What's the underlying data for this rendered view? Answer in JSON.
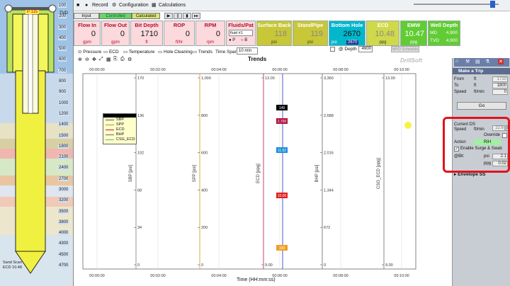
{
  "well": {
    "depths": [
      "100",
      "200",
      "300",
      "400",
      "500",
      "600",
      "700",
      "800",
      "900",
      "1000",
      "1200",
      "1400",
      "1500",
      "1800",
      "2100",
      "2400",
      "2700",
      "3000",
      "3200",
      "3500",
      "3800",
      "4000",
      "4300",
      "4500",
      "4700"
    ],
    "top_badge": "P 115",
    "bottom_label_1": "Sand Scan",
    "bottom_label_2": "ECD 10.48"
  },
  "toolbar": {
    "record": "Record",
    "configuration": "Configuration",
    "calculations": "Calculations",
    "tvd": "TVD"
  },
  "tabs": {
    "input": "Input",
    "controlled": "Controlled",
    "calculated": "Calculated"
  },
  "tiles": [
    {
      "title": "Flow In",
      "value": "0",
      "unit": "gpm"
    },
    {
      "title": "Flow Out",
      "value": "0",
      "unit": "gpm"
    },
    {
      "title": "Bit Depth",
      "value": "1710",
      "unit": "ft"
    },
    {
      "title": "ROP",
      "value": "0",
      "unit": "ft/hr"
    },
    {
      "title": "RPM",
      "value": "0",
      "unit": "rpm"
    }
  ],
  "fluids": {
    "title": "Fluids/Pat",
    "select": "fluid #1",
    "p": "P",
    "b": "B"
  },
  "pressure_tiles": [
    {
      "title": "Surface Back",
      "value": "118",
      "unit": "psi"
    },
    {
      "title": "StandPipe",
      "value": "119",
      "unit": "psi"
    },
    {
      "title": "Bottom Hole",
      "value": "2670",
      "unit": "psi",
      "extra": "2670"
    },
    {
      "title": "ECD",
      "value": "10.48",
      "unit": "ppg"
    },
    {
      "title": "EMW",
      "value": "10.47",
      "unit": "ppg"
    }
  ],
  "well_depth": {
    "title": "Well Depth",
    "md_label": "MD",
    "md": "4,900",
    "tvd_label": "TVD",
    "tvd": "4,900"
  },
  "depth_row": {
    "at_depth": "@ Depth",
    "depth_val": "4900",
    "mpd_btn": "MPD Schedule"
  },
  "view_tabs": [
    "Pressure",
    "ECD",
    "Temperature",
    "Hole Cleaning",
    "Trends"
  ],
  "time_span_label": "Time Span",
  "time_span_value": "10 min",
  "chart_title": "Trends",
  "brand": "DrillSoft",
  "chart_data": {
    "type": "line",
    "title": "Trends",
    "xlabel": "Time (HH:mm:ss)",
    "x_ticks": [
      "00:00:00",
      "00:02:00",
      "00:04:00",
      "00:06:00",
      "00:08:00",
      "00:10:00"
    ],
    "axes": [
      {
        "name": "SBP [psi]",
        "ticks": [
          "0",
          "34",
          "68",
          "102",
          "136",
          "170"
        ]
      },
      {
        "name": "SPP [psi]",
        "ticks": [
          "0",
          "200",
          "400",
          "600",
          "800",
          "1,000"
        ]
      },
      {
        "name": "ECD [ppg]",
        "ticks": [
          "9.00",
          "13.00"
        ]
      },
      {
        "name": "BHP [psi]",
        "ticks": [
          "0",
          "672",
          "1,344",
          "2,016",
          "2,688",
          "3,360"
        ]
      },
      {
        "name": "CSG_ECD [ppg]",
        "ticks": [
          "9.00",
          "13.00"
        ]
      }
    ],
    "legend": [
      "SBP",
      "SPP",
      "ECD",
      "BHP",
      "CSG_ECD"
    ],
    "markers": [
      {
        "label": "149",
        "color": "#000000"
      },
      {
        "label": "2,700",
        "color": "#b0103a"
      },
      {
        "label": "11.52",
        "color": "#1a8fd8"
      },
      {
        "label": "10.00",
        "color": "#e02020"
      },
      {
        "label": "100",
        "color": "#f0a020"
      }
    ]
  },
  "right_panel": {
    "make_trip": "Make a Trip",
    "from_label": "From",
    "from_val": "1710",
    "from_unit": "ft",
    "to_label": "To",
    "to_val": "1800",
    "to_unit": "ft",
    "speed_label": "Speed",
    "speed_unit": "ft/min",
    "speed_val": "0",
    "go": "Go",
    "current_ds": "Current DS",
    "current_speed": "Speed",
    "speed2_unit": "ft/min",
    "speed2_val": "22.6",
    "override": "Override",
    "action_label": "Action",
    "action_val": "RIH",
    "surge_swab": "Enable Surge & Swab",
    "at_bit": "@Bit",
    "psi_label": "psi",
    "psi_val": "2.1",
    "ppg_label": "ppg",
    "ppg_val": "0.02",
    "envelope": "Envelope SS"
  }
}
